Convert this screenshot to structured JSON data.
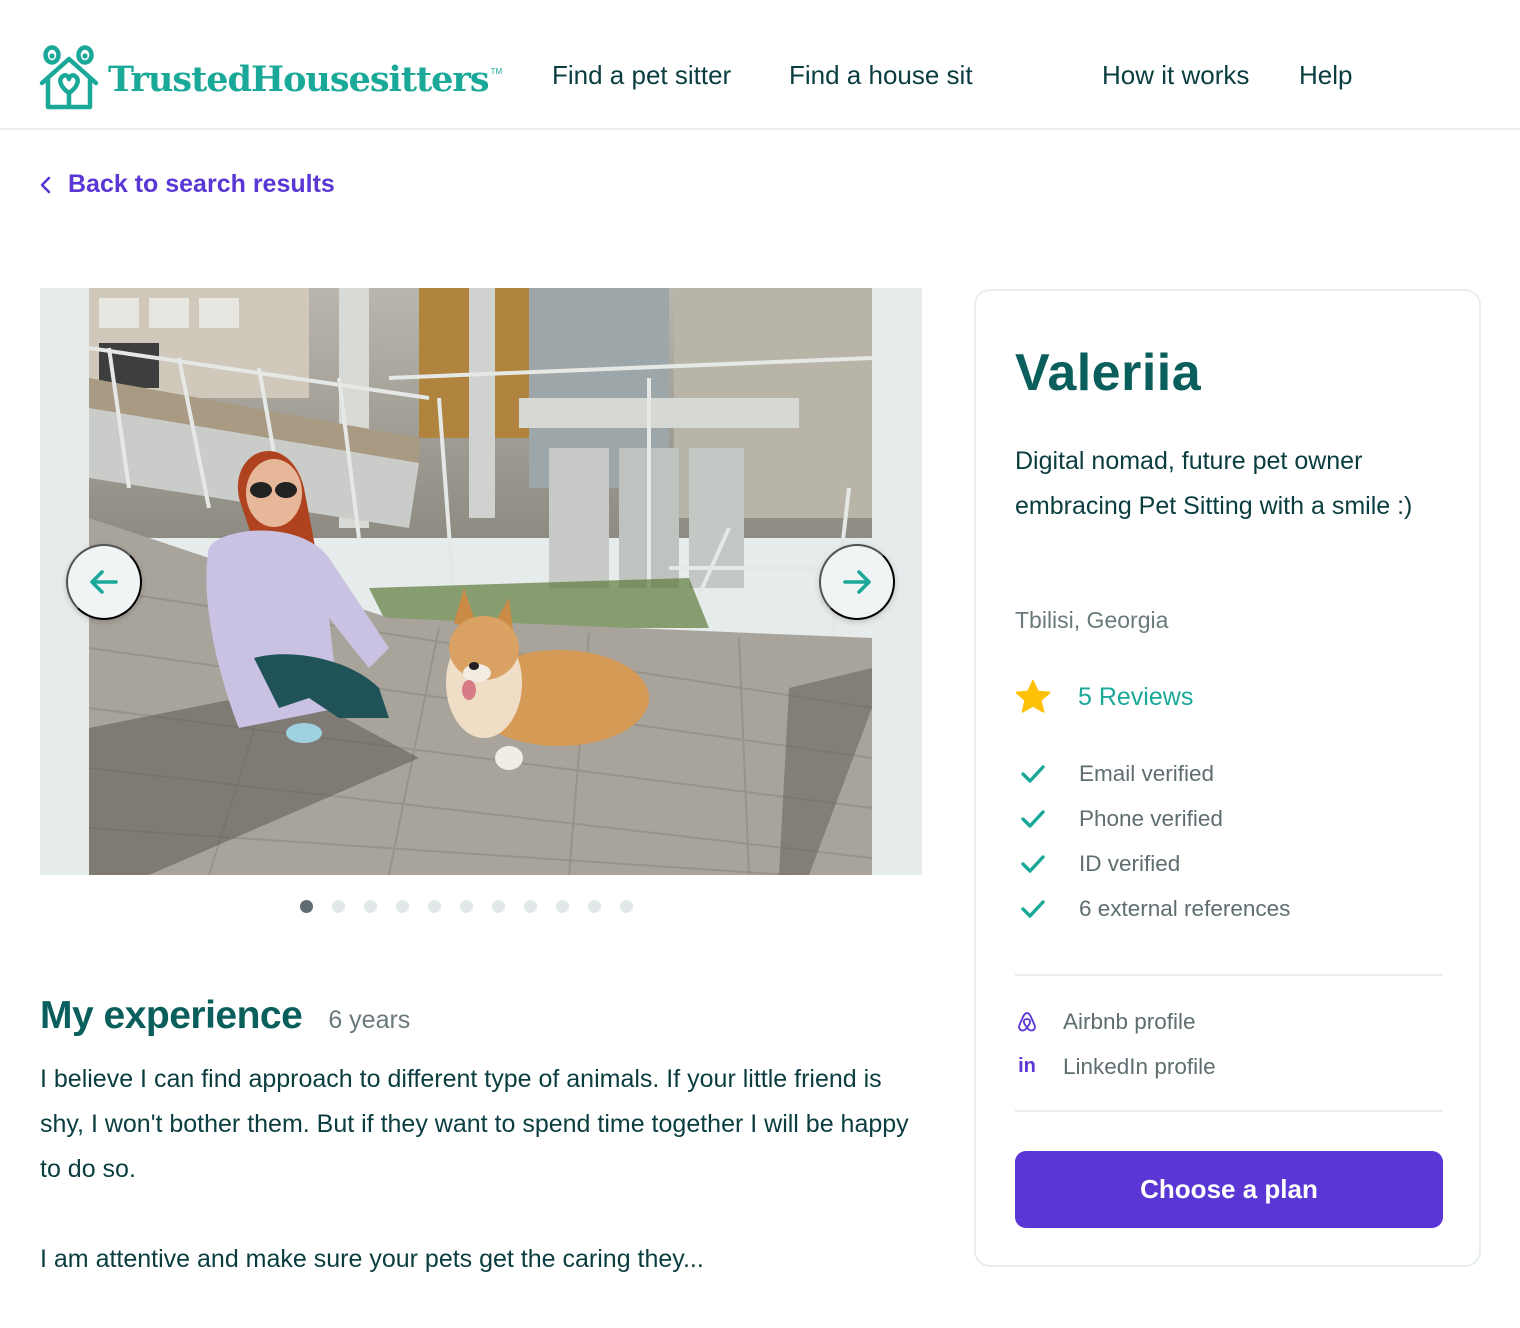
{
  "header": {
    "brand": "TrustedHousesitters",
    "brand_tm": "TM",
    "nav": [
      {
        "label": "Find a pet sitter"
      },
      {
        "label": "Find a house sit"
      },
      {
        "label": "How it works"
      },
      {
        "label": "Help"
      }
    ]
  },
  "back_link": {
    "label": "Back to search results",
    "icon": "chevron-left-icon"
  },
  "gallery": {
    "photo_alt": "Woman with red hair crouching next to a corgi on a wooden deck",
    "prev_icon": "arrow-left-icon",
    "next_icon": "arrow-right-icon",
    "total_photos": 11,
    "active_index": 0
  },
  "experience": {
    "title": "My experience",
    "years": "6 years",
    "paragraphs": [
      "I believe I can find approach to different type of animals. If your little friend is shy, I won't bother them. But if they want to spend time together I will be happy to do so.",
      "I am attentive and make sure your pets get the caring they..."
    ]
  },
  "profile": {
    "name": "Valeriia",
    "tagline": "Digital nomad, future pet owner embracing Pet Sitting with a smile :)",
    "location": "Tbilisi, Georgia",
    "reviews": {
      "label": "5 Reviews",
      "count": 5,
      "icon": "star-icon"
    },
    "verifications": [
      {
        "label": "Email verified",
        "icon": "check-icon"
      },
      {
        "label": "Phone verified",
        "icon": "check-icon"
      },
      {
        "label": "ID verified",
        "icon": "check-icon"
      },
      {
        "label": "6 external references",
        "icon": "check-icon"
      }
    ],
    "external_profiles": [
      {
        "label": "Airbnb profile",
        "icon": "airbnb-icon"
      },
      {
        "label": "LinkedIn profile",
        "icon": "linkedin-icon",
        "glyph": "in"
      }
    ],
    "cta_label": "Choose a plan"
  },
  "colors": {
    "brand_teal": "#1aa899",
    "dark_teal": "#0a5e5c",
    "text_dark": "#0a3d3f",
    "muted": "#5e6e70",
    "accent_purple": "#5a36d4",
    "star_yellow": "#ffc107"
  }
}
